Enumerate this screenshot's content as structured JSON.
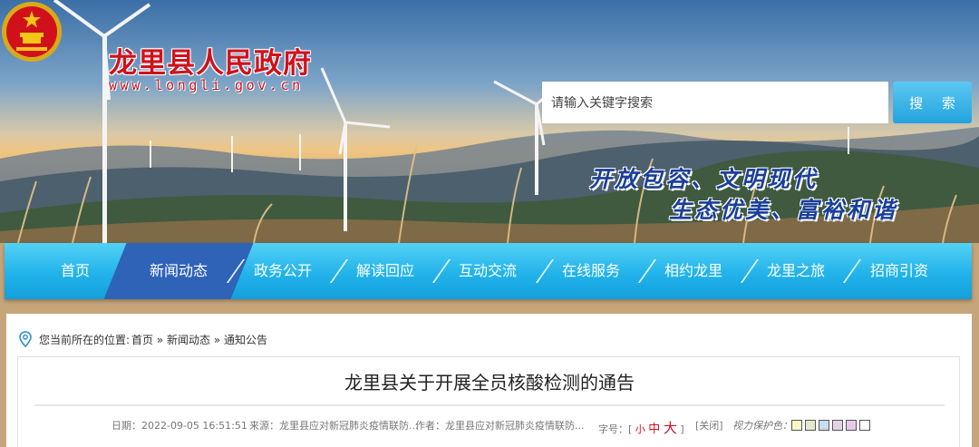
{
  "header": {
    "site_title": "龙里县人民政府",
    "site_url": "www.longli.gov.cn",
    "search_placeholder": "请输入关键字搜索",
    "search_button": "搜 索",
    "slogan_line1": "开放包容、文明现代",
    "slogan_line2": "生态优美、富裕和谐"
  },
  "nav": {
    "active": "新闻动态",
    "items": [
      "首页",
      "新闻动态",
      "政务公开",
      "解读回应",
      "互动交流",
      "在线服务",
      "相约龙里",
      "龙里之旅",
      "招商引资"
    ]
  },
  "breadcrumb": {
    "prefix": "您当前所在的位置:",
    "path": "首页 » 新闻动态 » 通知公告"
  },
  "article": {
    "title": "龙里县关于开展全员核酸检测的通告",
    "date": "日期：2022-09-05 16:51:51",
    "source": "来源：龙里县应对新冠肺炎疫情联防...",
    "author": "作者：龙里县应对新冠肺炎疫情联防...",
    "font_size_label": "字号：[",
    "font_small": "小",
    "font_medium": "中",
    "font_large": "大",
    "font_close": "]",
    "close": "[关闭]",
    "eye_protect_label": "视力保护色：",
    "eye_colors": [
      "#fbf6c8",
      "#e3e8cf",
      "#c9dbee",
      "#e7d1e5",
      "#e6cbe9",
      "#ffffff"
    ]
  },
  "colors": {
    "title_red": "#d0111b",
    "nav_blue": "#22b3ea",
    "nav_active": "#2f63b7",
    "slogan_blue": "#1a3f9a"
  }
}
